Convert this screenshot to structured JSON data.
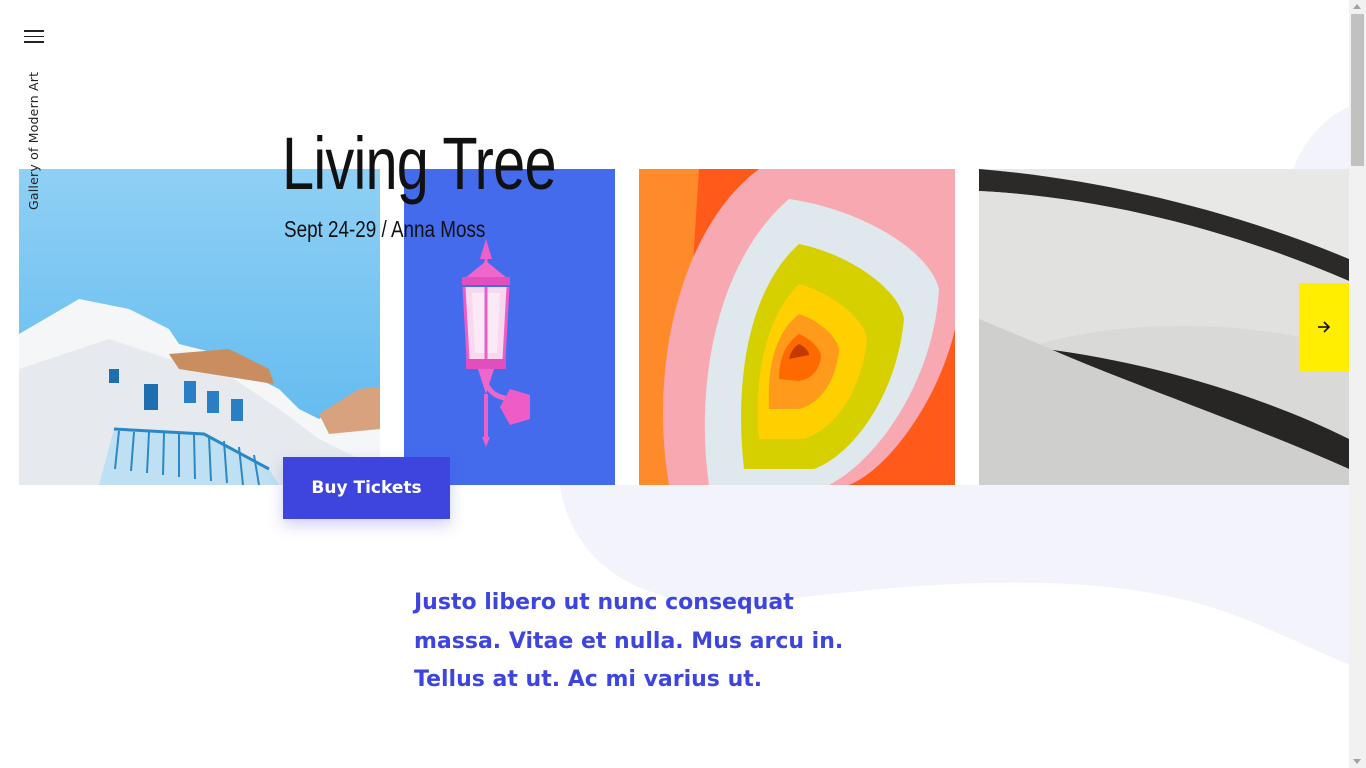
{
  "site": {
    "brand_name": "Gallery of Modern Art"
  },
  "navigation": {
    "menu_icon": "hamburger-menu-icon"
  },
  "event": {
    "title": "Living Tree",
    "meta": "Sept 24-29 / Anna Moss",
    "cta_label": "Buy Tickets"
  },
  "gallery": {
    "next_icon": "arrow-right-icon",
    "images": [
      {
        "subject": "white-building-blue-sky"
      },
      {
        "subject": "pink-lantern-blue-wall"
      },
      {
        "subject": "concentric-color-rings"
      },
      {
        "subject": "curved-architecture"
      }
    ]
  },
  "intro": {
    "text": "Justo libero ut nunc consequat massa. Vitae et nulla. Mus arcu in. Tellus at ut. Ac mi varius ut."
  },
  "colors": {
    "accent": "#3d45de",
    "next_button": "#ffee00",
    "text": "#111111",
    "background_wave": "#f3f4fb"
  }
}
